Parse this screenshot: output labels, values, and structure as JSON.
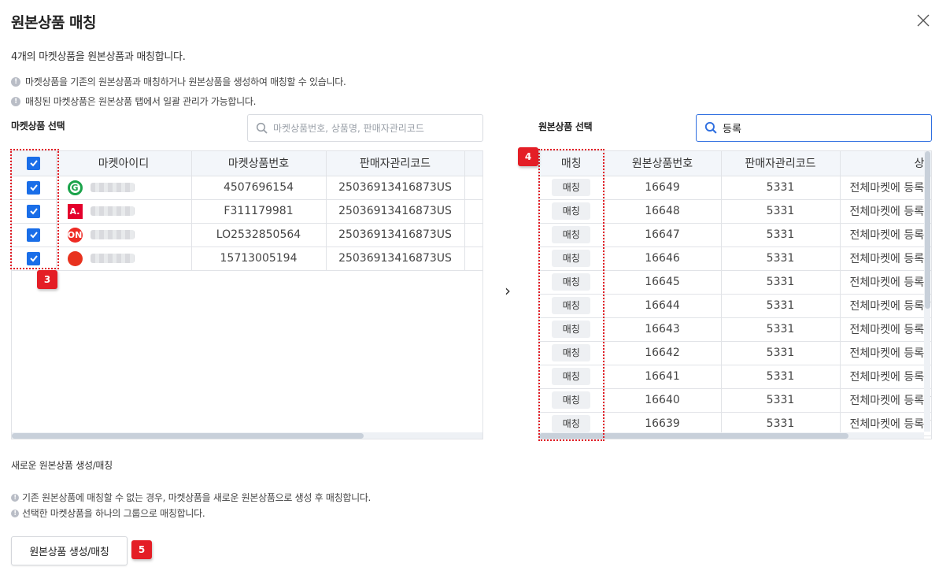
{
  "dialog": {
    "title": "원본상품 매칭",
    "summary": "4개의 마켓상품을 원본상품과 매칭합니다.",
    "info": [
      "마켓상품을 기존의 원본상품과 매칭하거나 원본상품을 생성하여 매칭할 수 있습니다.",
      "매칭된 마켓상품은 원본상품 탭에서 일괄 관리가 가능합니다."
    ]
  },
  "market": {
    "label": "마켓상품 선택",
    "search_placeholder": "마켓상품번호, 상품명, 판매자관리코드",
    "columns": [
      "마켓아이디",
      "마켓상품번호",
      "판매자관리코드"
    ],
    "rows": [
      {
        "logo": "G",
        "logo_color": "#1aa34a",
        "product_no": "4507696154",
        "code": "25036913416873US"
      },
      {
        "logo": "A.",
        "logo_color": "#e4002b",
        "product_no": "F311179981",
        "code": "25036913416873US"
      },
      {
        "logo": "ON",
        "logo_color": "#ee2a24",
        "product_no": "LO2532850564",
        "code": "25036913416873US"
      },
      {
        "logo": "",
        "logo_color": "#e8321e",
        "product_no": "15713005194",
        "code": "25036913416873US"
      }
    ]
  },
  "original": {
    "label": "원본상품 선택",
    "search_value": "등록",
    "columns": [
      "매칭",
      "원본상품번호",
      "판매자관리코드",
      "상"
    ],
    "match_label": "매칭",
    "rows": [
      {
        "no": "16649",
        "code": "5331",
        "name": "전체마켓에 등록"
      },
      {
        "no": "16648",
        "code": "5331",
        "name": "전체마켓에 등록"
      },
      {
        "no": "16647",
        "code": "5331",
        "name": "전체마켓에 등록"
      },
      {
        "no": "16646",
        "code": "5331",
        "name": "전체마켓에 등록"
      },
      {
        "no": "16645",
        "code": "5331",
        "name": "전체마켓에 등록"
      },
      {
        "no": "16644",
        "code": "5331",
        "name": "전체마켓에 등록하"
      },
      {
        "no": "16643",
        "code": "5331",
        "name": "전체마켓에 등록"
      },
      {
        "no": "16642",
        "code": "5331",
        "name": "전체마켓에 등록"
      },
      {
        "no": "16641",
        "code": "5331",
        "name": "전체마켓에 등록"
      },
      {
        "no": "16640",
        "code": "5331",
        "name": "전체마켓에 등록하"
      },
      {
        "no": "16639",
        "code": "5331",
        "name": "전체마켓에 등록하"
      }
    ]
  },
  "create": {
    "label": "새로운 원본상품 생성/매칭",
    "info": [
      "기존 원본상품에 매칭할 수 없는 경우, 마켓상품을 새로운 원본상품으로 생성 후 매칭합니다.",
      "선택한 마켓상품을 하나의 그룹으로 매칭합니다."
    ],
    "button_label": "원본상품 생성/매칭"
  },
  "arrow": "›",
  "badges": [
    "3",
    "4",
    "5"
  ],
  "info_icon": "!"
}
